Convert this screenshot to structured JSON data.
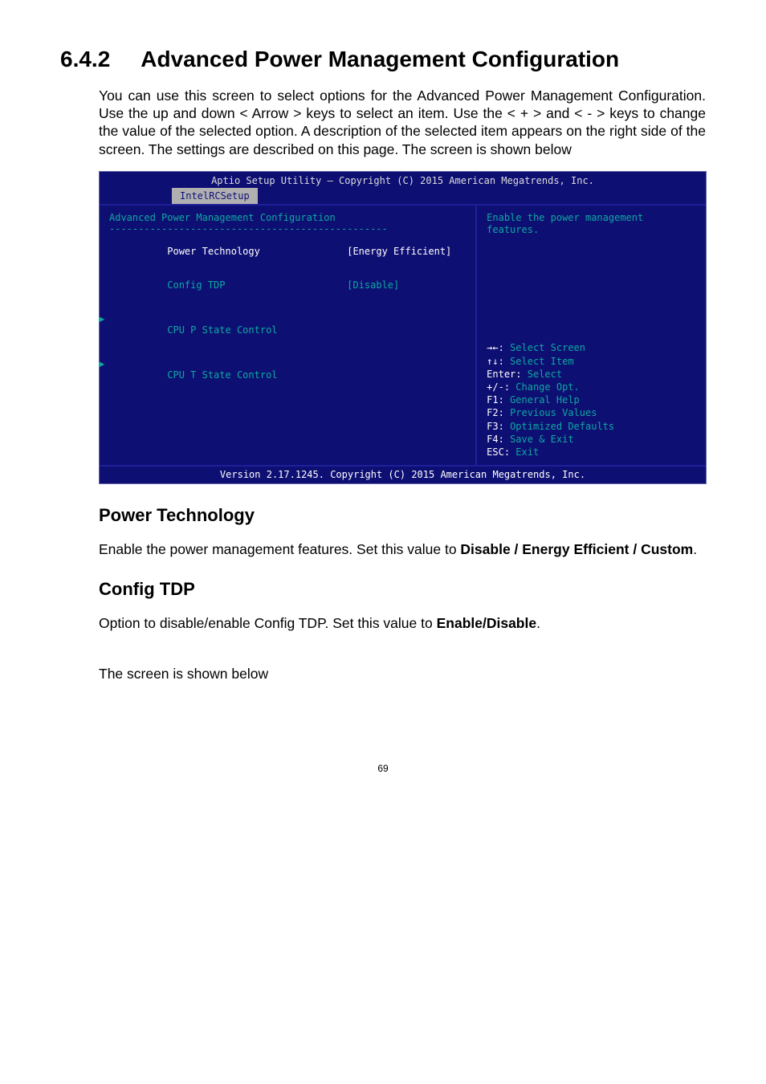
{
  "section": {
    "number": "6.4.2",
    "title": "Advanced Power Management Configuration"
  },
  "intro": "You can use this screen to select options for the Advanced Power Management Configuration. Use the up and down < Arrow > keys to select an item. Use the < + > and < - > keys to change the value of the selected option. A description of the selected item appears on the right side of the screen. The settings are described on this page. The screen is shown below",
  "bios": {
    "titlebar": "Aptio Setup Utility – Copyright (C) 2015 American Megatrends, Inc.",
    "tab": "IntelRCSetup",
    "panel_title": "Advanced Power Management Configuration",
    "hr": "------------------------------------------------",
    "items": {
      "power_tech_label": "Power Technology",
      "power_tech_value": "[Energy Efficient]",
      "config_tdp_label": "Config TDP",
      "config_tdp_value": "[Disable]",
      "cpu_p_label": "CPU P State Control",
      "cpu_t_label": "CPU T State Control"
    },
    "help_text": "Enable the power management features.",
    "nav": {
      "l1_key": "→←:",
      "l1_txt": " Select Screen",
      "l2_key": "↑↓:",
      "l2_txt": " Select Item",
      "l3_key": "Enter:",
      "l3_txt": " Select",
      "l4_key": "+/-:",
      "l4_txt": " Change Opt.",
      "l5_key": "F1:",
      "l5_txt": " General Help",
      "l6_key": "F2:",
      "l6_txt": " Previous Values",
      "l7_key": "F3:",
      "l7_txt": " Optimized Defaults",
      "l8_key": "F4:",
      "l8_txt": " Save & Exit",
      "l9_key": "ESC:",
      "l9_txt": " Exit"
    },
    "footer": "Version 2.17.1245. Copyright (C) 2015 American Megatrends, Inc."
  },
  "sub1": {
    "heading": "Power Technology",
    "text_pre": "Enable the power management features. Set this value to ",
    "text_bold": "Disable / Energy Efficient / Custom",
    "text_post": "."
  },
  "sub2": {
    "heading": "Config TDP",
    "text_pre": "Option to disable/enable Config TDP. Set this value to ",
    "text_bold": "Enable/Disable",
    "text_post": "."
  },
  "tail": "The screen is shown below",
  "page_number": "69"
}
